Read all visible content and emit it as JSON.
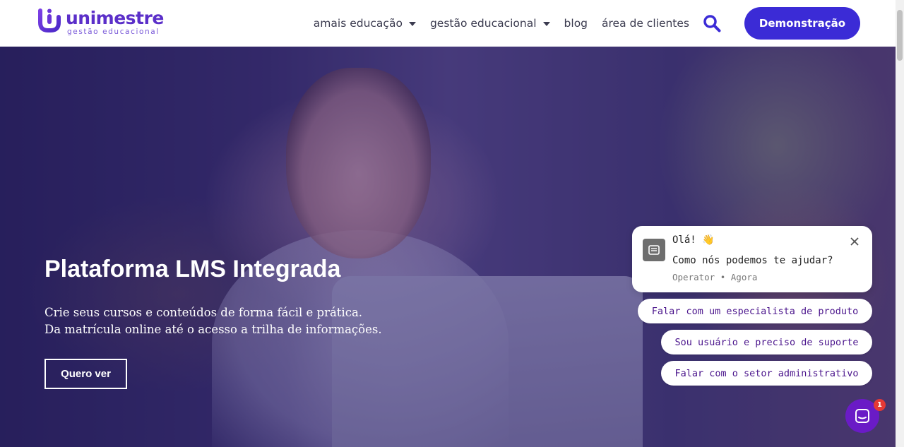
{
  "brand": {
    "name": "unimestre",
    "tagline": "gestão educacional",
    "colors": {
      "primary": "#3b2bd6",
      "logo": "#5b2fc9",
      "chat_accent": "#6a1bc6",
      "badge": "#e53935"
    }
  },
  "nav": {
    "items": [
      {
        "label": "amais educação",
        "has_dropdown": true
      },
      {
        "label": "gestão educacional",
        "has_dropdown": true
      },
      {
        "label": "blog",
        "has_dropdown": false
      },
      {
        "label": "área de clientes",
        "has_dropdown": false
      }
    ],
    "search_icon": "search-icon",
    "cta_label": "Demonstração"
  },
  "hero": {
    "title": "Plataforma LMS Integrada",
    "lines": [
      "Crie seus cursos e conteúdos de forma fácil e prática.",
      "Da matrícula online até o acesso a trilha de informações."
    ],
    "button_label": "Quero ver"
  },
  "chat": {
    "greeting": "Olá! 👋",
    "message": "Como nós podemos te ajudar?",
    "meta": "Operator • Agora",
    "options": [
      "Falar com um especialista de produto",
      "Sou usuário e preciso de suporte",
      "Falar com o setor administrativo"
    ],
    "unread_count": "1"
  }
}
